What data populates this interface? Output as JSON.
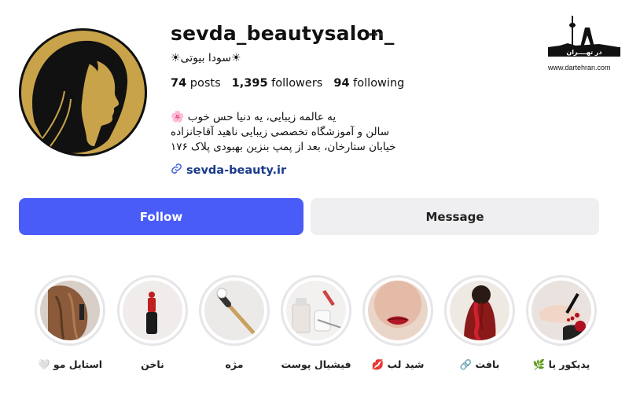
{
  "profile": {
    "username": "sevda_beautysalon_",
    "more": "···",
    "full_name": "☀سودا بیوتی☀",
    "stats": {
      "posts_count": "74",
      "posts_label": "posts",
      "followers_count": "1,395",
      "followers_label": "followers",
      "following_count": "94",
      "following_label": "following"
    },
    "bio": {
      "line1": "یه عالمه زیبایی، یه دنیا حس خوب",
      "line1_emoji": "🌸",
      "line2": "سالن و آموزشگاه تخصصی زیبایی ناهید آقاجانزاده",
      "line3": "خیابان ستارخان، بعد از پمپ بنزین بهبودی پلاک ۱۷۶"
    },
    "link": "sevda-beauty.ir"
  },
  "actions": {
    "follow_label": "Follow",
    "message_label": "Message"
  },
  "watermark": {
    "title": "در تهــــران",
    "url": "www.dartehran.com"
  },
  "highlights": [
    {
      "label": "پدیکور یا 🌿",
      "icon": "pedicure-photo"
    },
    {
      "label": "بافت 🔗",
      "icon": "braid-photo"
    },
    {
      "label": "شید لب 💋",
      "icon": "lips-photo"
    },
    {
      "label": "فیشیال پوست",
      "icon": "facial-photo"
    },
    {
      "label": "مژه",
      "icon": "lash-brush-photo"
    },
    {
      "label": "ناخن",
      "icon": "nail-polish-photo"
    },
    {
      "label": "استایل مو 🤍",
      "icon": "hair-styling-photo"
    }
  ],
  "colors": {
    "follow_button": "#4a5cf8",
    "message_button": "#efeff1",
    "avatar_gold": "#c9a34a",
    "highlight_ring": "#e6e6ea"
  }
}
